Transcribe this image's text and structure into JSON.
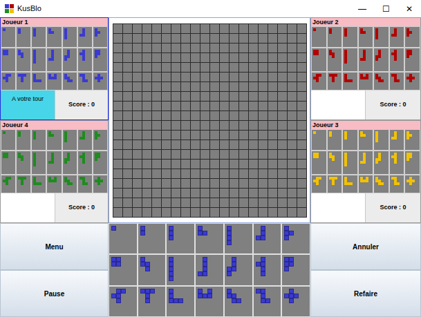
{
  "window": {
    "title": "KusBlo",
    "controls": [
      "—",
      "☐",
      "✕"
    ]
  },
  "players": [
    {
      "name": "Joueur 1",
      "color": "#3a3ad0",
      "status": "A votre tour",
      "score": "Score : 0",
      "selected": true
    },
    {
      "name": "Joueur 2",
      "color": "#b30000",
      "status": "",
      "score": "Score : 0",
      "selected": false
    },
    {
      "name": "Joueur 3",
      "color": "#f2c200",
      "status": "",
      "score": "Score : 0",
      "selected": false
    },
    {
      "name": "Joueur 4",
      "color": "#1e8c1e",
      "status": "",
      "score": "Score : 0",
      "selected": false
    }
  ],
  "pieces": [
    {
      "cells": [
        "1"
      ]
    },
    {
      "cells": [
        "1",
        "1"
      ]
    },
    {
      "cells": [
        "1",
        "1",
        "1"
      ]
    },
    {
      "cells": [
        "10",
        "11"
      ]
    },
    {
      "cells": [
        "1",
        "1",
        "1",
        "1"
      ]
    },
    {
      "cells": [
        "01",
        "01",
        "11"
      ]
    },
    {
      "cells": [
        "10",
        "11",
        "10"
      ]
    },
    {
      "cells": [
        "11",
        "11"
      ]
    },
    {
      "cells": [
        "10",
        "11",
        "01"
      ]
    },
    {
      "cells": [
        "1",
        "1",
        "1",
        "1",
        "1"
      ]
    },
    {
      "cells": [
        "01",
        "01",
        "01",
        "11"
      ]
    },
    {
      "cells": [
        "01",
        "01",
        "11",
        "10"
      ]
    },
    {
      "cells": [
        "01",
        "11",
        "01",
        "01"
      ]
    },
    {
      "cells": [
        "11",
        "11",
        "10"
      ]
    },
    {
      "cells": [
        "011",
        "110",
        "010"
      ]
    },
    {
      "cells": [
        "111",
        "010",
        "010"
      ]
    },
    {
      "cells": [
        "100",
        "100",
        "111"
      ]
    },
    {
      "cells": [
        "101",
        "111"
      ]
    },
    {
      "cells": [
        "100",
        "110",
        "011"
      ]
    },
    {
      "cells": [
        "110",
        "010",
        "011"
      ]
    },
    {
      "cells": [
        "010",
        "111",
        "010"
      ]
    }
  ],
  "board": {
    "size": 20,
    "filled": []
  },
  "buttons": {
    "left": [
      "Menu",
      "Pause"
    ],
    "right": [
      "Annuler",
      "Refaire"
    ]
  }
}
